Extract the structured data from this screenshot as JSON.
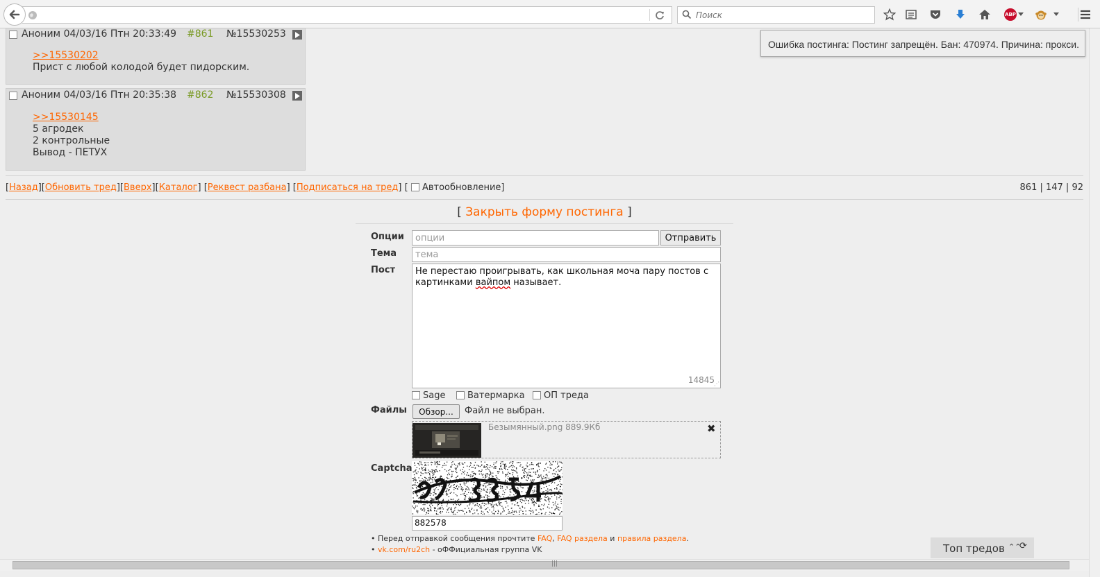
{
  "browser": {
    "search_placeholder": "Поиск",
    "abp_label": "ABP"
  },
  "posts": [
    {
      "author": "Аноним",
      "date": "04/03/16 Птн 20:33:49",
      "num": "#861",
      "id": "№15530253",
      "reply_link": ">>15530202",
      "lines": [
        "Прист с любой колодой будет пидорским."
      ]
    },
    {
      "author": "Аноним",
      "date": "04/03/16 Птн 20:35:38",
      "num": "#862",
      "id": "№15530308",
      "reply_link": ">>15530145",
      "lines": [
        "5 агродек",
        "2 контрольные",
        "Вывод - ПЕТУХ"
      ]
    }
  ],
  "error_notice": "Ошибка постинга: Постинг запрещён. Бан: 470974. Причина: прокси.",
  "nav": {
    "back": "Назад",
    "refresh": "Обновить тред",
    "up": "Вверх",
    "catalog": "Каталог",
    "request": "Реквест разбана",
    "subscribe": "Подписаться на тред",
    "autoupdate": "Автообновление",
    "stats": "861 | 147 | 92"
  },
  "form": {
    "close_label": "Закрыть форму постинга",
    "options_label": "Опции",
    "options_placeholder": "опции",
    "send": "Отправить",
    "subject_label": "Тема",
    "subject_placeholder": "тема",
    "post_label": "Пост",
    "post_text_a": "Не перестаю проигрывать, как школьная моча пару постов с картинками ",
    "post_text_misspelled": "вайпом",
    "post_text_b": " называет.",
    "char_counter": "14845",
    "sage": "Sage",
    "watermark": "Ватермарка",
    "op": "ОП треда",
    "files_label": "Файлы",
    "browse": "Обзор...",
    "no_file": "Файл не выбран.",
    "file_name": "Безымянный.png 889.9Кб",
    "captcha_label": "Captcha",
    "captcha_value": "882578"
  },
  "rules": {
    "line1_prefix": "• Перед отправкой сообщения прочтите ",
    "faq": "FAQ",
    "faq_section": "FAQ раздела",
    "and": " и ",
    "rules": "правила раздела",
    "line2_link": "vk.com/ru2ch",
    "line2_suffix": " - оФФициальная группа VK"
  },
  "top_threads": "Топ тредов",
  "colors": {
    "link": "#ff6600",
    "post_num": "#789922",
    "post_bg": "#dddddd",
    "page_bg": "#eeeeee"
  }
}
